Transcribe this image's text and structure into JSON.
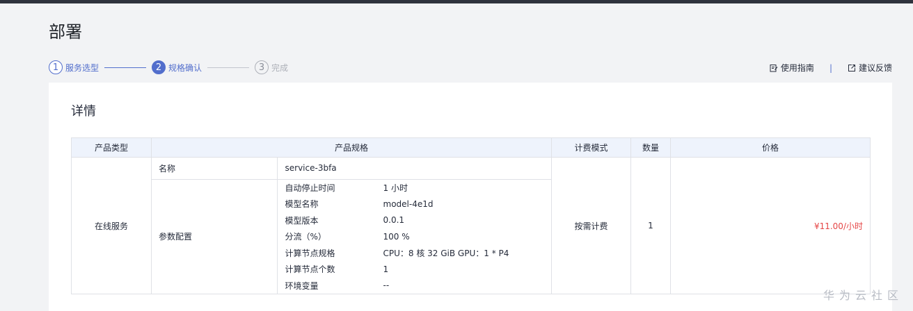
{
  "page": {
    "title": "部署"
  },
  "steps": [
    {
      "num": "1",
      "label": "服务选型"
    },
    {
      "num": "2",
      "label": "规格确认"
    },
    {
      "num": "3",
      "label": "完成"
    }
  ],
  "header_links": {
    "guide": "使用指南",
    "divider": "|",
    "feedback": "建议反馈"
  },
  "card": {
    "title": "详情"
  },
  "table": {
    "headers": [
      "产品类型",
      "产品规格",
      "计费模式",
      "数量",
      "价格"
    ],
    "row": {
      "product_type": "在线服务",
      "billing": "按需计费",
      "quantity": "1",
      "price": "¥11.00/小时",
      "name_key": "名称",
      "name_value": "service-3bfa",
      "params_key": "参数配置",
      "params": [
        {
          "k": "自动停止时间",
          "v": "1 小时"
        },
        {
          "k": "模型名称",
          "v": "model-4e1d"
        },
        {
          "k": "模型版本",
          "v": "0.0.1"
        },
        {
          "k": "分流（%）",
          "v": "100 %"
        },
        {
          "k": "计算节点规格",
          "v": "CPU：8 核 32 GiB GPU：1 * P4"
        },
        {
          "k": "计算节点个数",
          "v": "1"
        },
        {
          "k": "环境变量",
          "v": "--"
        }
      ]
    }
  },
  "watermark": "华为云社区",
  "colors": {
    "accent": "#526ecc",
    "price": "#e54545",
    "header_bg": "#eef3fc"
  }
}
